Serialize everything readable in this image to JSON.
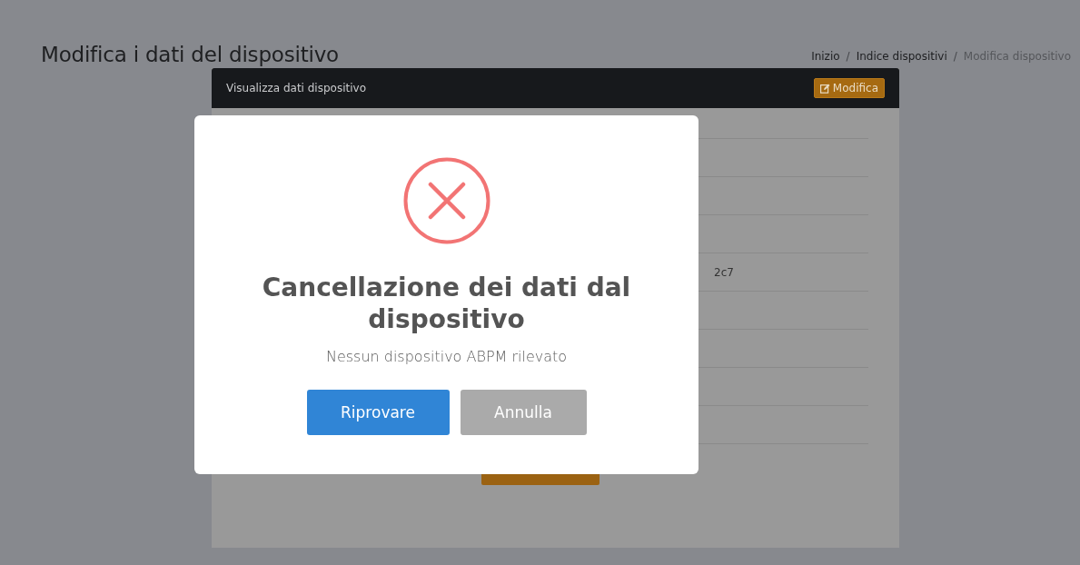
{
  "page": {
    "title": "Modifica i dati del dispositivo"
  },
  "breadcrumb_separator": "/",
  "breadcrumb": [
    {
      "label": "Inizio",
      "current": false
    },
    {
      "label": "Indice dispositivi",
      "current": false
    },
    {
      "label": "Modifica dispositivo",
      "current": true
    }
  ],
  "card": {
    "title": "Visualizza dati dispositivo",
    "edit_button": "Modifica",
    "visible_value": "2c7"
  },
  "dialog": {
    "kind": "error",
    "title": "Cancellazione dei dati dal dispositivo",
    "message": "Nessun dispositivo ABPM rilevato",
    "buttons": [
      {
        "label": "Riprovare",
        "kind": "confirm"
      },
      {
        "label": "Annulla",
        "kind": "cancel"
      }
    ]
  }
}
